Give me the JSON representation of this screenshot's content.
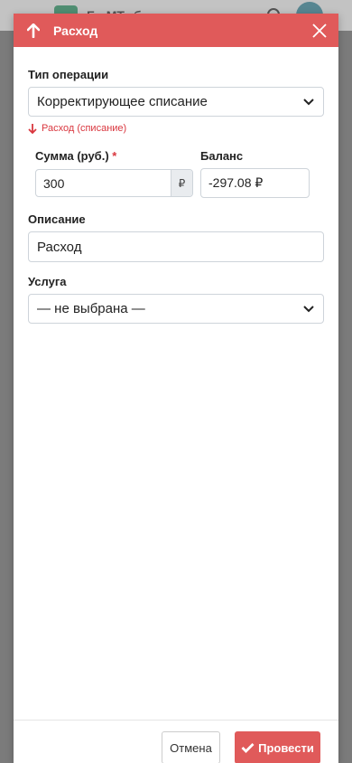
{
  "background_app": {
    "title": "Б...МТ...б"
  },
  "modal": {
    "title": "Расход",
    "colors": {
      "accent": "#e05a5a",
      "danger_text": "#d9363e"
    },
    "operation_type": {
      "label": "Тип операции",
      "value": "Корректирующее списание",
      "hint": "Расход (списание)"
    },
    "amount": {
      "label": "Сумма (руб.)",
      "required_mark": "*",
      "value": "300",
      "currency": "₽"
    },
    "balance": {
      "label": "Баланс",
      "value": "-297.08 ₽"
    },
    "description": {
      "label": "Описание",
      "value": "Расход"
    },
    "service": {
      "label": "Услуга",
      "value": "— не выбрана —"
    },
    "footer": {
      "cancel_label": "Отмена",
      "submit_label": "Провести"
    }
  }
}
